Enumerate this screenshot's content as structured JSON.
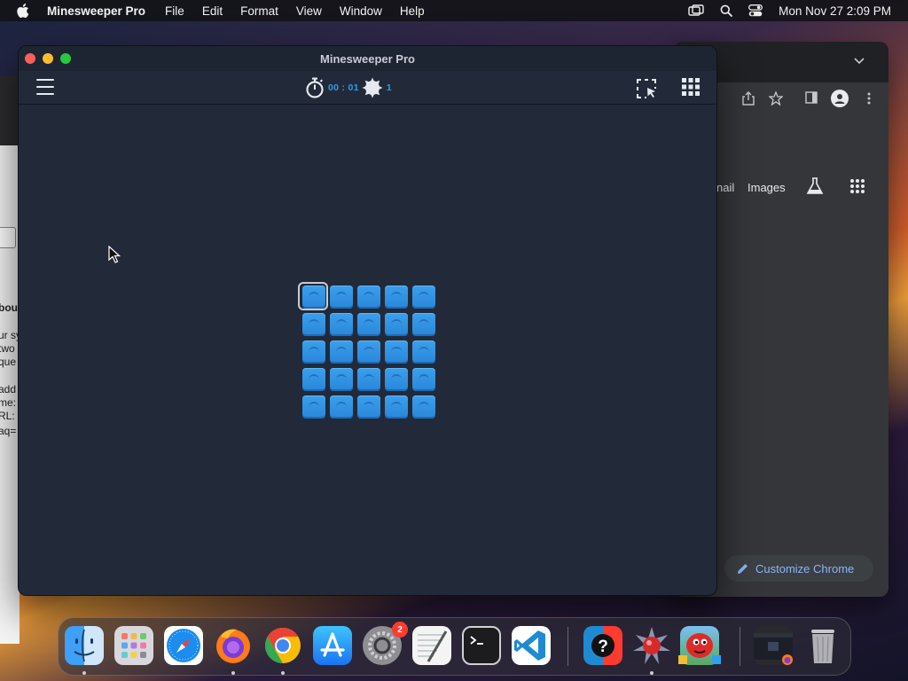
{
  "menubar": {
    "app_name": "Minesweeper Pro",
    "items": [
      "File",
      "Edit",
      "Format",
      "View",
      "Window",
      "Help"
    ],
    "clock": "Mon Nov 27  2:09 PM"
  },
  "background_window": {
    "lines": [
      "bou",
      "ur sy",
      "two",
      "que",
      "add",
      "me:",
      "RL:",
      "aq="
    ]
  },
  "chrome": {
    "gmail_partial": "nail",
    "images_link": "Images",
    "customize_button": "Customize Chrome"
  },
  "minesweeper": {
    "window_title": "Minesweeper Pro",
    "timer": "00 : 01",
    "mine_count": "1",
    "board": {
      "rows": 5,
      "cols": 5,
      "selected_cell": {
        "row": 0,
        "col": 0
      }
    }
  },
  "dock": {
    "apps": [
      {
        "name": "Finder",
        "running": true
      },
      {
        "name": "Launchpad",
        "running": false
      },
      {
        "name": "Safari",
        "running": false
      },
      {
        "name": "Firefox",
        "running": true
      },
      {
        "name": "Chrome",
        "running": true
      },
      {
        "name": "App Store",
        "running": false
      },
      {
        "name": "System Settings",
        "running": false,
        "badge": "2"
      },
      {
        "name": "TextEdit",
        "running": false
      },
      {
        "name": "Terminal",
        "running": false
      },
      {
        "name": "Visual Studio Code",
        "running": false
      },
      {
        "name": "Help",
        "running": false
      },
      {
        "name": "Minesweeper Pro",
        "running": true
      },
      {
        "name": "Game",
        "running": false
      },
      {
        "name": "Window Preview",
        "running": false
      },
      {
        "name": "Trash",
        "running": false
      }
    ]
  }
}
